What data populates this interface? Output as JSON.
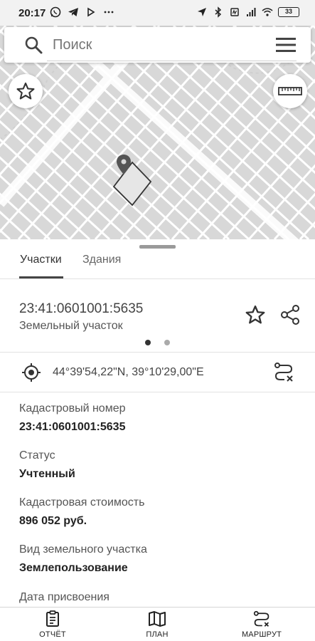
{
  "status_bar": {
    "time": "20:17",
    "battery": "33",
    "icons_left": [
      "whatsapp-icon",
      "telegram-icon",
      "play-icon",
      "more-dots-icon"
    ],
    "icons_right": [
      "location-icon",
      "bluetooth-icon",
      "vibrate-icon",
      "signal-4g-icon",
      "wifi-icon",
      "battery-icon"
    ]
  },
  "search": {
    "placeholder": "Поиск"
  },
  "tabs": [
    {
      "label": "Участки",
      "active": true
    },
    {
      "label": "Здания",
      "active": false
    }
  ],
  "parcel": {
    "number": "23:41:0601001:5635",
    "type": "Земельный участок",
    "page_dots": 2,
    "active_dot": 1
  },
  "coords": {
    "text": "44°39'54,22\"N, 39°10'29,00\"E"
  },
  "fields": [
    {
      "label": "Кадастровый номер",
      "value": "23:41:0601001:5635"
    },
    {
      "label": "Статус",
      "value": "Учтенный"
    },
    {
      "label": "Кадастровая стоимость",
      "value": "896 052 руб."
    },
    {
      "label": "Вид земельного участка",
      "value": "Землепользование"
    },
    {
      "label": "Дата присвоения",
      "value": ""
    }
  ],
  "bottom_nav": [
    {
      "label": "ОТЧЁТ",
      "icon": "report-icon"
    },
    {
      "label": "ПЛАН",
      "icon": "map-icon"
    },
    {
      "label": "МАРШРУТ",
      "icon": "route-icon"
    }
  ],
  "colors": {
    "map_background": "#d8d8d8",
    "map_lines": "#ffffff",
    "accent": "#444444"
  }
}
